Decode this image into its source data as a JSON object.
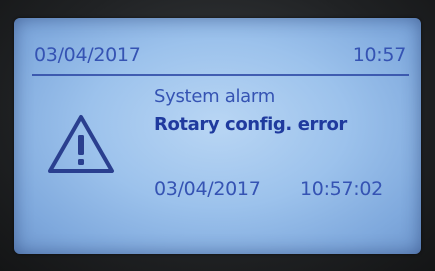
{
  "header": {
    "date": "03/04/2017",
    "time": "10:57"
  },
  "alarm": {
    "icon": "warning-triangle-icon",
    "title": "System alarm",
    "message": "Rotary config. error",
    "date": "03/04/2017",
    "time": "10:57:02"
  },
  "colors": {
    "lcd_background": "#9cc2ec",
    "lcd_text": "#3553b3",
    "lcd_text_bold": "#1f3a9e"
  }
}
